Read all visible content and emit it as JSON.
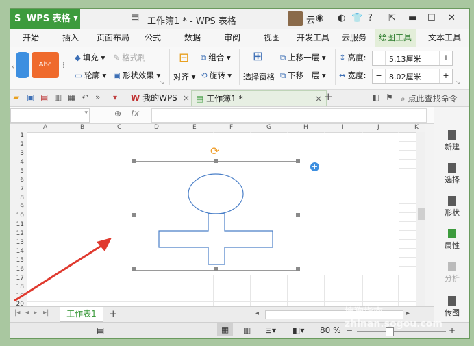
{
  "titlebar": {
    "app_logo": "S",
    "app_name": "WPS 表格",
    "document_title": "工作簿1 * - WPS 表格",
    "user_label": "云",
    "help_label": "?"
  },
  "menu": {
    "tabs": [
      "开始",
      "插入",
      "页面布局",
      "公式",
      "数据",
      "审阅",
      "视图",
      "开发工具",
      "云服务",
      "绘图工具",
      "文本工具"
    ],
    "active": "绘图工具"
  },
  "ribbon": {
    "style_sample_label": "Abc",
    "fill_label": "填充",
    "format_brush_label": "格式刷",
    "outline_label": "轮廓",
    "shape_effect_label": "形状效果",
    "align_label": "对齐",
    "group_label": "组合",
    "rotate_label": "旋转",
    "selection_pane_label": "选择窗格",
    "bring_forward_label": "上移一层",
    "send_backward_label": "下移一层",
    "height_label": "高度:",
    "height_value": "5.13厘米",
    "width_label": "宽度:",
    "width_value": "8.02厘米",
    "minus": "−",
    "plus": "+"
  },
  "tabstrip": {
    "tabs": [
      {
        "label": "我的WPS",
        "close": "×"
      },
      {
        "label": "工作簿1 *",
        "close": "×"
      }
    ],
    "add": "+",
    "search_label": "点此查找命令"
  },
  "formula_bar": {
    "name_box": "",
    "zoom_icon": "🔍",
    "fx": "fx"
  },
  "grid": {
    "columns": [
      "A",
      "B",
      "C",
      "D",
      "E",
      "F",
      "G",
      "H",
      "I",
      "J",
      "K"
    ],
    "rows": [
      "1",
      "2",
      "3",
      "4",
      "5",
      "6",
      "7",
      "8",
      "9",
      "10",
      "11",
      "12",
      "13",
      "14",
      "15",
      "16",
      "17",
      "18",
      "19",
      "20"
    ]
  },
  "side_panel": {
    "items": [
      "新建",
      "选择",
      "形状",
      "属性",
      "分析",
      "传图"
    ]
  },
  "sheets": {
    "tabs": [
      "工作表1"
    ],
    "add": "+"
  },
  "statusbar": {
    "zoom": "80 %",
    "minus": "−",
    "plus": "+"
  },
  "watermark": "搜狗指南  zhinan.sogou.com",
  "colors": {
    "accent_green": "#3d9b3d",
    "shape_stroke": "#4a7fc8",
    "arrow_red": "#e03a2f",
    "rotate_handle": "#f0a030"
  }
}
